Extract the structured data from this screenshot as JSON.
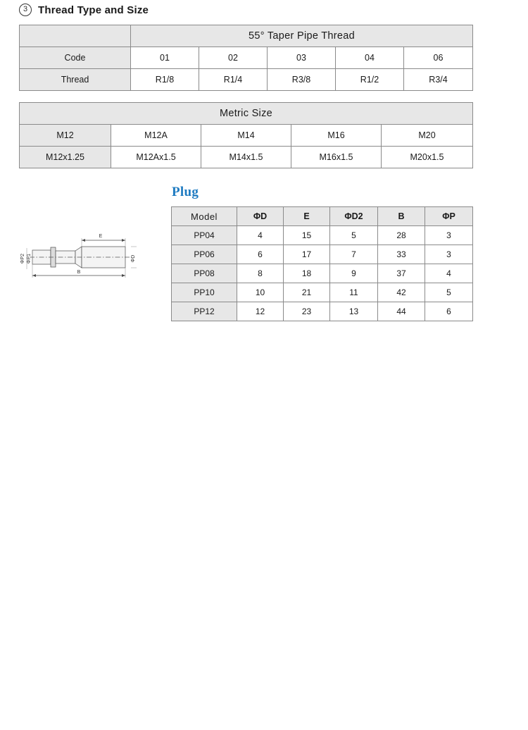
{
  "section": {
    "number": "3",
    "title": "Thread Type and Size"
  },
  "thread_table": {
    "corner_label": "",
    "group_header": "55°  Taper Pipe Thread",
    "rows": [
      {
        "label": "Code",
        "values": [
          "01",
          "02",
          "03",
          "04",
          "06"
        ]
      },
      {
        "label": "Thread",
        "values": [
          "R1/8",
          "R1/4",
          "R3/8",
          "R1/2",
          "R3/4"
        ]
      }
    ]
  },
  "metric_table": {
    "group_header": "Metric Size",
    "rows": [
      {
        "values": [
          "M12",
          "M12A",
          "M14",
          "M16",
          "M20"
        ]
      },
      {
        "values": [
          "M12x1.25",
          "M12Ax1.5",
          "M14x1.5",
          "M16x1.5",
          "M20x1.5"
        ]
      }
    ]
  },
  "plug": {
    "heading": "Plug",
    "columns": [
      "Model",
      "ΦD",
      "E",
      "ΦD2",
      "B",
      "ΦP"
    ],
    "rows": [
      {
        "model": "PP04",
        "values": [
          "4",
          "15",
          "5",
          "28",
          "3"
        ]
      },
      {
        "model": "PP06",
        "values": [
          "6",
          "17",
          "7",
          "33",
          "3"
        ]
      },
      {
        "model": "PP08",
        "values": [
          "8",
          "18",
          "9",
          "37",
          "4"
        ]
      },
      {
        "model": "PP10",
        "values": [
          "10",
          "21",
          "11",
          "42",
          "5"
        ]
      },
      {
        "model": "PP12",
        "values": [
          "12",
          "23",
          "13",
          "44",
          "6"
        ]
      }
    ]
  },
  "drawing": {
    "labels": {
      "p2": "ΦP2",
      "p1": "ΦP1",
      "d": "ΦD",
      "e": "E",
      "b": "B"
    }
  },
  "colors": {
    "heading_blue": "#1f7bc1",
    "table_gray": "#e7e7e7",
    "border_gray": "#8a8a8a"
  }
}
